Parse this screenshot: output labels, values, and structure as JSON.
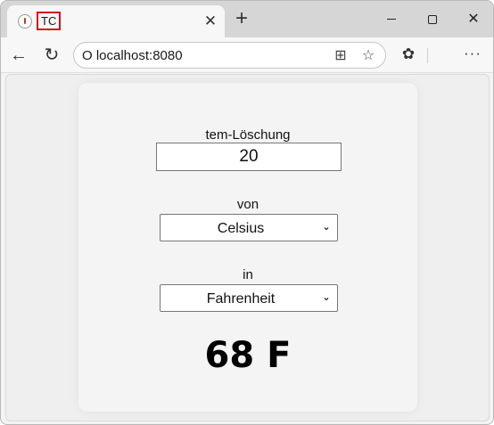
{
  "browser": {
    "tab": {
      "title": "TC",
      "close_glyph": "✕"
    },
    "new_tab_glyph": "+",
    "window_controls": {
      "close_glyph": "✕"
    },
    "address": {
      "url": "O localhost:8080"
    },
    "icons": {
      "back": "←",
      "reload": "↻",
      "apps": "⊞",
      "favorite": "☆",
      "extensions": "✿",
      "menu": "···"
    }
  },
  "converter": {
    "temperature_label": "tem-Löschung",
    "temperature_value": "20",
    "from_label": "von",
    "from_selected": "Celsius",
    "to_label": "in",
    "to_selected": "Fahrenheit",
    "result": "68 F"
  }
}
